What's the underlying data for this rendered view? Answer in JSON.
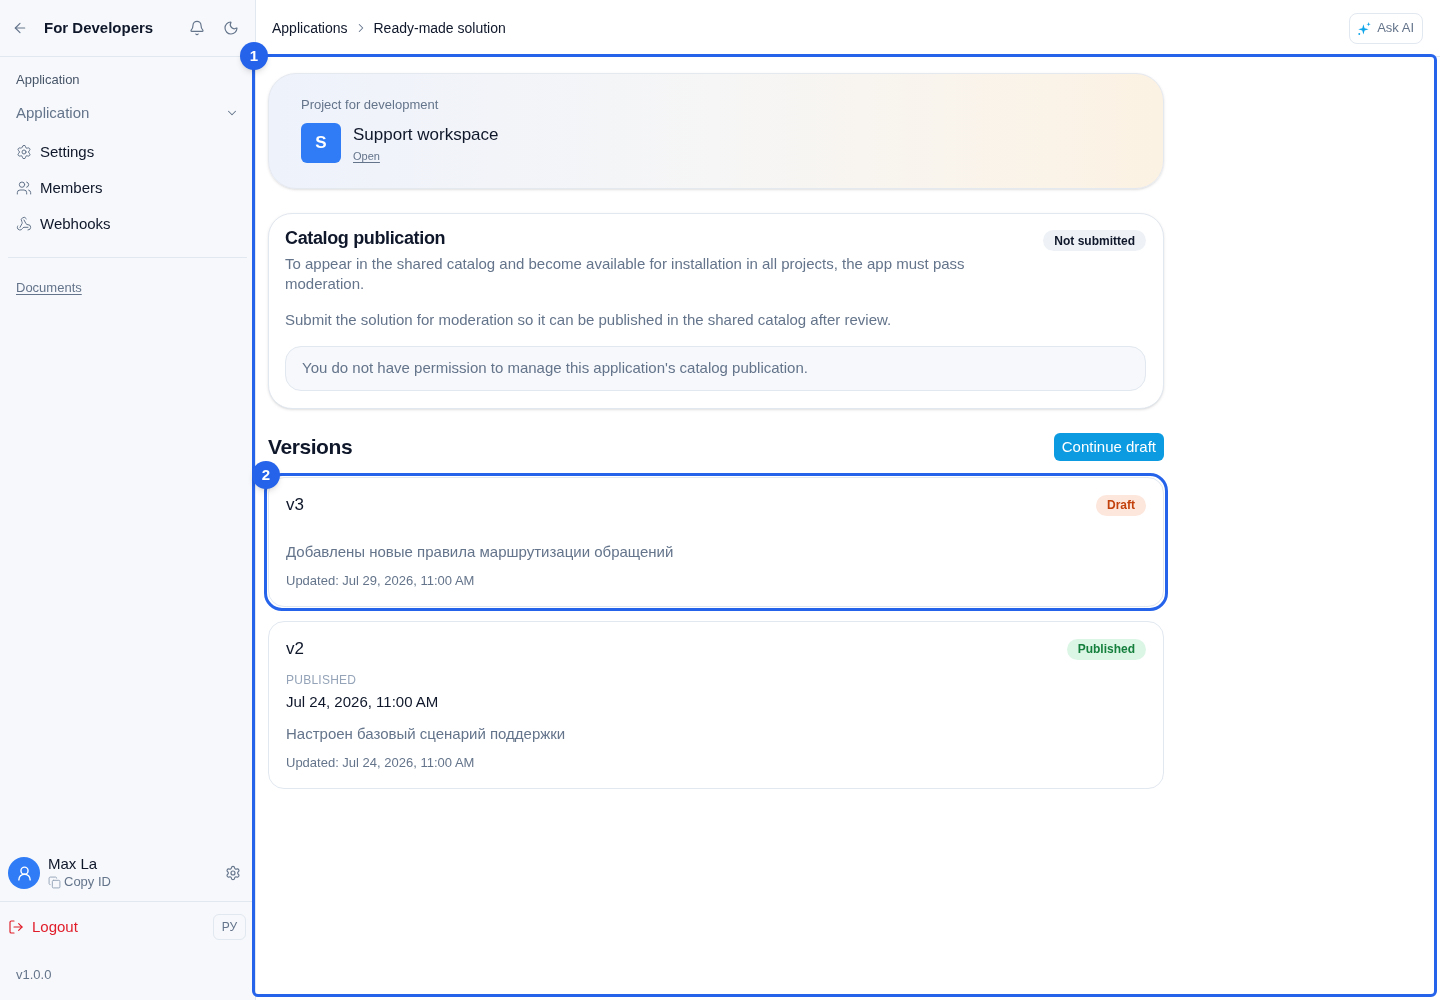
{
  "sidebar": {
    "title": "For Developers",
    "section_label": "Application",
    "app_select": {
      "value": "Application"
    },
    "nav_items": [
      {
        "kind": "settings",
        "label": "Settings"
      },
      {
        "kind": "members",
        "label": "Members"
      },
      {
        "kind": "webhooks",
        "label": "Webhooks"
      }
    ],
    "documents_link": "Documents",
    "user": {
      "name": "Max La",
      "copy_id": "Copy ID"
    },
    "logout": "Logout",
    "language": "РУ",
    "version": "v1.0.0"
  },
  "topbar": {
    "breadcrumb": [
      "Applications",
      "Ready-made solution"
    ],
    "ask_ai": "Ask AI"
  },
  "main": {
    "highlight": "1",
    "project": {
      "label": "Project for development",
      "initial": "S",
      "name": "Support workspace",
      "link": "Open"
    },
    "catalog": {
      "title": "Catalog publication",
      "status": "Not submitted",
      "paragraphs": [
        "To appear in the shared catalog and become available for installation in all projects, the app must pass moderation.",
        "Submit the solution for moderation so it can be published in the shared catalog after review."
      ],
      "notice": "You do not have permission to manage this application's catalog publication."
    },
    "versions": {
      "title": "Versions",
      "action": "Continue draft",
      "items": [
        {
          "name": "v3",
          "kind": "draft",
          "status": "Draft",
          "description": "Добавлены новые правила маршрутизации обращений",
          "updated": "Updated: Jul 29, 2026, 11:00 AM",
          "highlight": "2"
        },
        {
          "name": "v2",
          "kind": "published",
          "status": "Published",
          "published": {
            "label": "PUBLISHED",
            "date": "Jul 24, 2026, 11:00 AM"
          },
          "description": "Настроен базовый сценарий поддержки",
          "updated": "Updated: Jul 24, 2026, 11:00 AM"
        }
      ]
    }
  }
}
